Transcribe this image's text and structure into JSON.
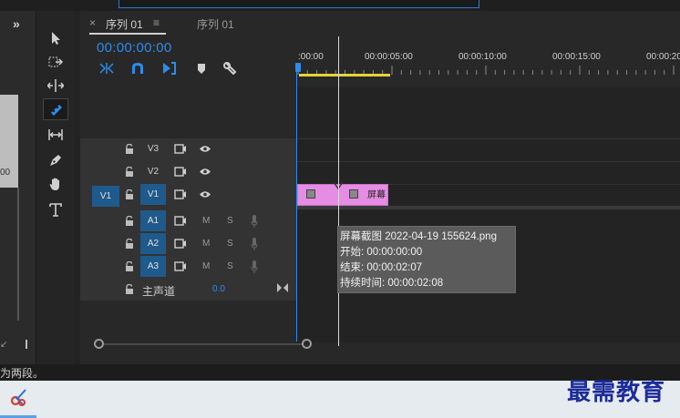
{
  "panel": {
    "collapse_glyph": "»",
    "left_value": "00"
  },
  "tabs": [
    {
      "label": "序列 01",
      "close": "×",
      "menu": "≡",
      "active": true
    },
    {
      "label": "序列 01",
      "active": false
    }
  ],
  "timecode": "00:00:00:00",
  "ruler": {
    "labels": [
      ":00:00",
      "00:00:05:00",
      "00:00:10:00",
      "00:00:15:00",
      "00:00:20"
    ]
  },
  "source_patch": "V1",
  "video_tracks": [
    {
      "label": "V3",
      "targeted": false
    },
    {
      "label": "V2",
      "targeted": false
    },
    {
      "label": "V1",
      "targeted": true
    }
  ],
  "audio_tracks": [
    {
      "label": "A1",
      "mute": "M",
      "solo": "S"
    },
    {
      "label": "A2",
      "mute": "M",
      "solo": "S"
    },
    {
      "label": "A3",
      "mute": "M",
      "solo": "S"
    }
  ],
  "master": {
    "label": "主声道",
    "value": "0.0"
  },
  "clip": {
    "label": "屏幕",
    "color": "#e58ce4"
  },
  "tooltip": {
    "name": "屏幕截图 2022-04-19 155624.png",
    "start": "开始: 00:00:00:00",
    "end": "结束: 00:00:02:07",
    "duration": "持续时间: 00:00:02:08"
  },
  "status": {
    "text": "为两段。"
  },
  "watermark": "最需教育",
  "colors": {
    "accent": "#2d8ceb",
    "track_target": "#1f5a8c",
    "work_area": "#e5d337"
  },
  "icons": {
    "tools": [
      "selection-tool-icon",
      "track-select-forward-icon",
      "ripple-edit-icon",
      "razor-tool-icon",
      "slip-tool-icon",
      "pen-tool-icon",
      "hand-tool-icon",
      "type-tool-icon"
    ],
    "header": [
      "insert-nest-icon",
      "snap-magnet-icon",
      "linked-selection-icon",
      "add-marker-icon",
      "wrench-settings-icon"
    ]
  }
}
